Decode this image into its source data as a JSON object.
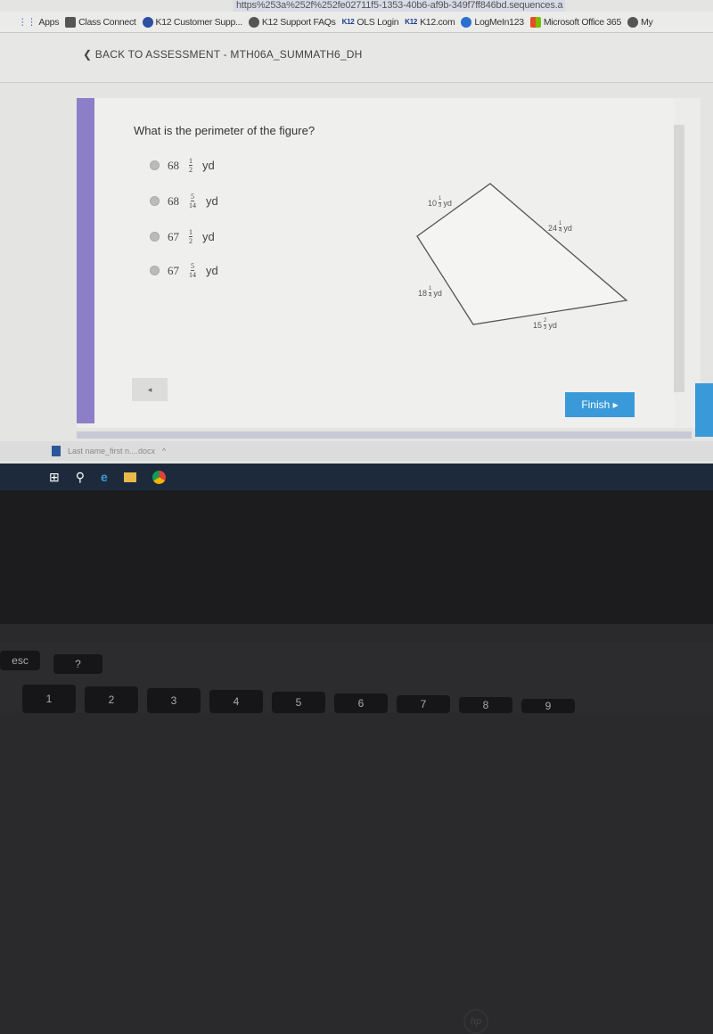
{
  "browser": {
    "url_fragment": "https%253a%252f%252fe02711f5-1353-40b6-af9b-349f7ff846bd.sequences.a",
    "bookmarks": [
      "Apps",
      "Class Connect",
      "K12 Customer Supp...",
      "K12 Support FAQs",
      "OLS Login",
      "K12.com",
      "LogMeIn123",
      "Microsoft Office 365",
      "My"
    ],
    "k12_badge": "K12"
  },
  "nav": {
    "back_label": "BACK TO ASSESSMENT - MTH06A_SUMMATH6_DH"
  },
  "question": {
    "text": "What is the perimeter of the figure?",
    "options": [
      {
        "whole": "68",
        "num": "1",
        "den": "2",
        "unit": "yd"
      },
      {
        "whole": "68",
        "num": "5",
        "den": "14",
        "unit": "yd"
      },
      {
        "whole": "67",
        "num": "1",
        "den": "2",
        "unit": "yd"
      },
      {
        "whole": "67",
        "num": "5",
        "den": "14",
        "unit": "yd"
      }
    ]
  },
  "figure": {
    "shape": "quadrilateral",
    "sides": [
      {
        "whole": "10",
        "num": "1",
        "den": "3",
        "unit": "yd"
      },
      {
        "whole": "24",
        "num": "1",
        "den": "4",
        "unit": "yd"
      },
      {
        "whole": "15",
        "num": "2",
        "den": "3",
        "unit": "yd"
      },
      {
        "whole": "18",
        "num": "1",
        "den": "4",
        "unit": "yd"
      }
    ]
  },
  "buttons": {
    "prev": "◂",
    "finish": "Finish ▸"
  },
  "download": {
    "file": "Last name_first n....docx",
    "chevron": "^"
  },
  "taskbar": {
    "icons": [
      "windows-icon",
      "search-icon",
      "edge-icon",
      "file-explorer-icon",
      "chrome-icon"
    ]
  },
  "laptop": {
    "brand": "hp",
    "keys": [
      "esc",
      "?",
      "1",
      "2",
      "3",
      "4",
      "5",
      "6",
      "7",
      "8",
      "9"
    ]
  },
  "colors": {
    "accent_bar": "#8c7fc8",
    "finish": "#3a9ad9"
  }
}
